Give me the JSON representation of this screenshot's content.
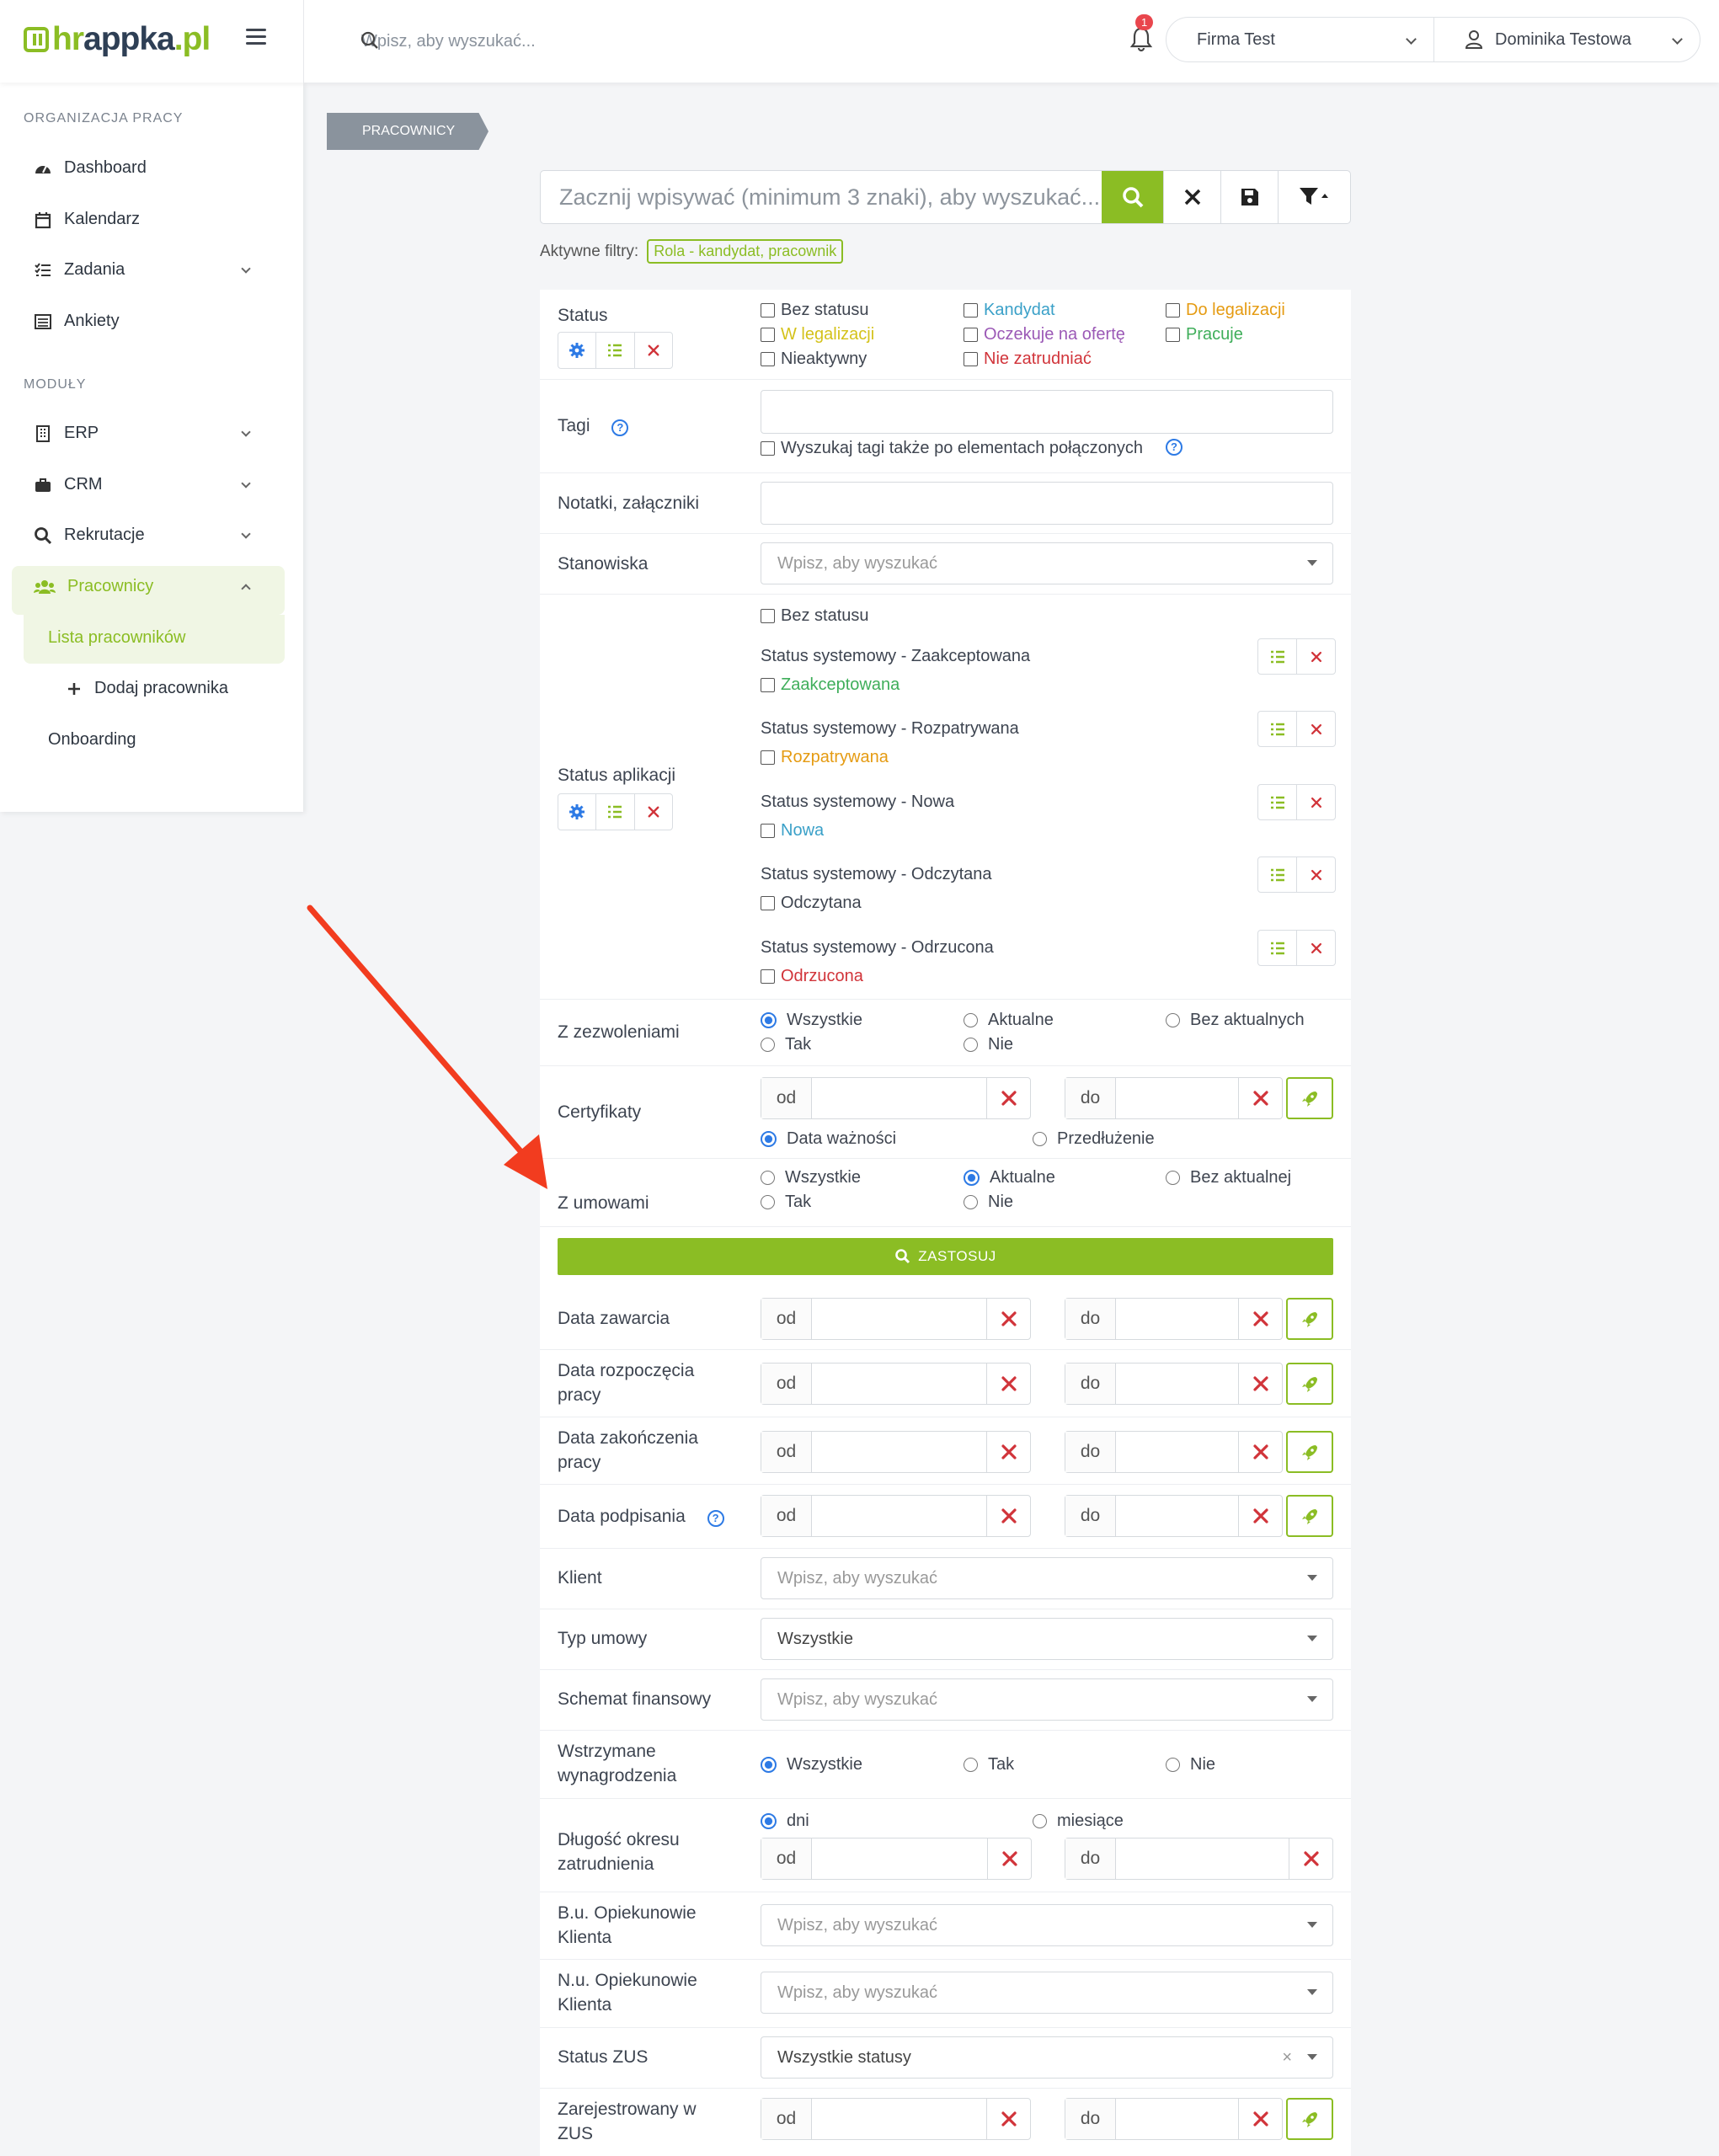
{
  "brand": {
    "name_prefix": "hr",
    "name_main": "appka",
    "name_suffix": ".pl"
  },
  "topbar": {
    "search_placeholder": "Wpisz, aby wyszukać...",
    "notifications_count": "1",
    "company": "Firma Test",
    "user": "Dominika Testowa"
  },
  "sidebar": {
    "section1": "ORGANIZACJA PRACY",
    "section2": "MODUŁY",
    "items": {
      "dashboard": "Dashboard",
      "calendar": "Kalendarz",
      "tasks": "Zadania",
      "surveys": "Ankiety",
      "erp": "ERP",
      "crm": "CRM",
      "recruitment": "Rekrutacje",
      "employees": "Pracownicy",
      "employee_list": "Lista pracowników",
      "add_employee": "Dodaj pracownika",
      "onboarding": "Onboarding"
    }
  },
  "breadcrumb": "PRACOWNICY",
  "main_search": {
    "placeholder": "Zacznij wpisywać (minimum 3 znaki), aby wyszukać..."
  },
  "active_filters": {
    "label": "Aktywne filtry:",
    "tag": "Rola - kandydat, pracownik"
  },
  "colors": {
    "accent": "#8bbd24",
    "blue": "#2d7ae5",
    "red": "#d1343a",
    "orange": "#e59b12",
    "purple": "#9b59b6",
    "teal": "#3aa0c8"
  },
  "form": {
    "status": {
      "label": "Status",
      "options": [
        "Bez statusu",
        "Kandydat",
        "Do legalizacji",
        "W legalizacji",
        "Oczekuje na ofertę",
        "Pracuje",
        "Nieaktywny",
        "Nie zatrudniać"
      ]
    },
    "tags": {
      "label": "Tagi",
      "also_linked": "Wyszukaj tagi także po elementach połączonych"
    },
    "notes": {
      "label": "Notatki, załączniki"
    },
    "positions": {
      "label": "Stanowiska",
      "placeholder": "Wpisz, aby wyszukać"
    },
    "app_status": {
      "label": "Status aplikacji",
      "no_status": "Bez statusu",
      "groups": [
        {
          "title": "Status systemowy - Zaakceptowana",
          "option": "Zaakceptowana"
        },
        {
          "title": "Status systemowy - Rozpatrywana",
          "option": "Rozpatrywana"
        },
        {
          "title": "Status systemowy - Nowa",
          "option": "Nowa"
        },
        {
          "title": "Status systemowy - Odczytana",
          "option": "Odczytana"
        },
        {
          "title": "Status systemowy - Odrzucona",
          "option": "Odrzucona"
        }
      ]
    },
    "permits": {
      "label": "Z zezwoleniami",
      "options": [
        "Wszystkie",
        "Aktualne",
        "Bez aktualnych",
        "Tak",
        "Nie"
      ]
    },
    "certs": {
      "label": "Certyfikaty",
      "from": "od",
      "to": "do",
      "opt1": "Data ważności",
      "opt2": "Przedłużenie"
    },
    "contracts": {
      "label": "Z umowami",
      "options": [
        "Wszystkie",
        "Aktualne",
        "Bez aktualnej",
        "Tak",
        "Nie"
      ]
    },
    "apply": "ZASTOSUJ",
    "date_concluded": {
      "label": "Data zawarcia"
    },
    "date_start": {
      "label": "Data rozpoczęcia pracy"
    },
    "date_end": {
      "label": "Data zakończenia pracy"
    },
    "date_signed": {
      "label": "Data podpisania"
    },
    "client": {
      "label": "Klient",
      "placeholder": "Wpisz, aby wyszukać"
    },
    "contract_type": {
      "label": "Typ umowy",
      "value": "Wszystkie"
    },
    "fin_scheme": {
      "label": "Schemat finansowy",
      "placeholder": "Wpisz, aby wyszukać"
    },
    "withheld": {
      "label": "Wstrzymane wynagrodzenia",
      "options": [
        "Wszystkie",
        "Tak",
        "Nie"
      ]
    },
    "duration": {
      "label": "Długość okresu zatrudnienia",
      "opt1": "dni",
      "opt2": "miesiące"
    },
    "bu_guardians": {
      "label": "B.u. Opiekunowie Klienta",
      "placeholder": "Wpisz, aby wyszukać"
    },
    "nu_guardians": {
      "label": "N.u. Opiekunowie Klienta",
      "placeholder": "Wpisz, aby wyszukać"
    },
    "zus_status": {
      "label": "Status ZUS",
      "value": "Wszystkie statusy"
    },
    "zus_registered": {
      "label": "Zarejestrowany w ZUS"
    }
  }
}
